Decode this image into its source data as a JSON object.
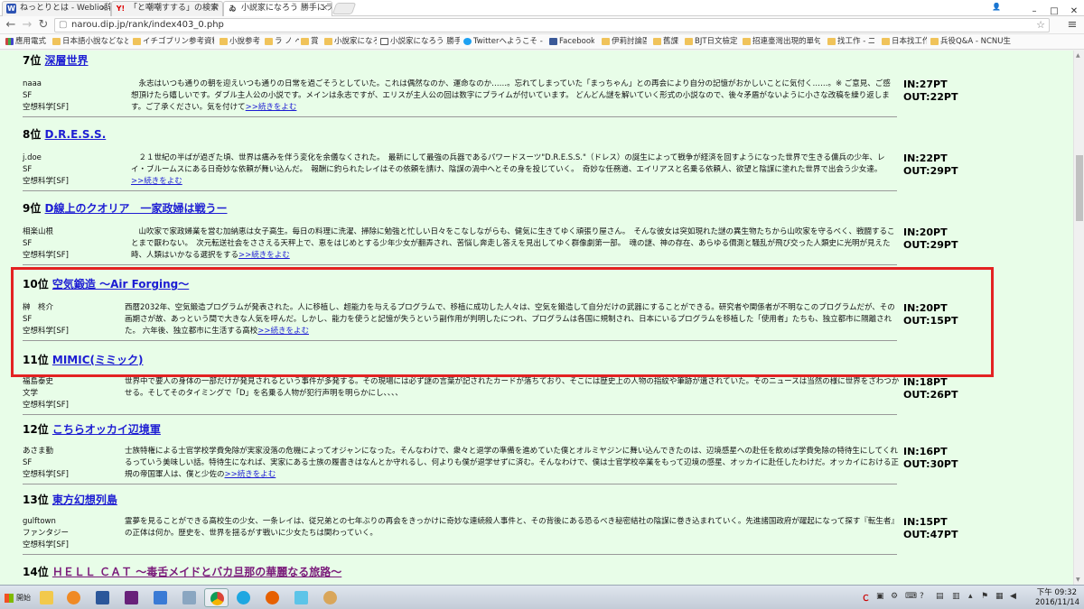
{
  "browser": {
    "tabs": [
      {
        "icon": "W",
        "title": "ねっとりとは - Weblio辞",
        "color": "#2c52b3"
      },
      {
        "icon": "Y!",
        "title": "「と嘲嘲すする」の検索",
        "color": "#d00"
      },
      {
        "icon": "ゐ",
        "title": "小説家になろう 勝手にラ",
        "color": "#333"
      }
    ],
    "url": "narou.dip.jp/rank/index403_0.php",
    "bookmarks": [
      "應用電式",
      "日本語小說などなど",
      "イチゴブリン参考資料",
      "小說参考",
      "ラ ノ ベ",
      "賞",
      "小說家になろう",
      "小説家になろう 勝手…",
      "Twitterへようこそ -",
      "Facebook",
      "伊莉討論區",
      "舊課",
      "BJT日文檢定",
      "招連臺灣出現的單句",
      "找工作 - 二",
      "日本找工作",
      "兵役Q&A - NCNU生"
    ]
  },
  "ranking": [
    {
      "rank": "7位",
      "title": "深層世界",
      "author": "naaa",
      "genre": "SF",
      "category": "空想科学[SF]",
      "synopsis": "　永志はいつも通りの朝を迎えいつも通りの日常を過ごそうとしていた。これは偶然なのか、運命なのか……。忘れてしまっていた「まっちゃん」との再会により自分の記憶がおかしいことに気付く……。※ ご意見、ご感想頂けたら嬉しいです。ダブル主人公の小説です。メインは永志ですが、エリスが主人公の回は数字にプライムが付いています。 どんどん謎を解いていく形式の小説なので、後々矛盾がないように小さな改稿を繰り返します。ご了承ください。気を付けて",
      "more": ">>続きをよむ",
      "in": "IN:27PT",
      "out": "OUT:22PT"
    },
    {
      "rank": "8位",
      "title": "D.R.E.S.S.",
      "author": "j.doe",
      "genre": "SF",
      "category": "空想科学[SF]",
      "synopsis": "　２１世紀の半ばが過ぎた頃、世界は痛みを伴う変化を余儀なくされた。　最新にして最強の兵器であるパワードスーツ\"D.R.E.S.S.\"（ドレス）の誕生によって戦争が経済を回すようになった世界で生きる傭兵の少年、レイ・ブルームスにある日奇妙な依頼が舞い込んだ。　報酬に釣られたレイはその依頼を請け、陰謀の渦中へとその身を投じていく。　奇妙な任務道、エイリアスと名乗る依頼人、欲望と陰謀に塗れた世界で出会う少女達。",
      "more": ">>続きをよむ",
      "in": "IN:22PT",
      "out": "OUT:29PT"
    },
    {
      "rank": "9位",
      "title": "D線上のクオリア　一家政婦は戦うー",
      "author": "相楽山根",
      "genre": "SF",
      "category": "空想科学[SF]",
      "synopsis": "　山吹家で家政婦業を営む加納恵は女子高生。毎日の料理に洗濯、掃除に勉強と忙しい日々をこなしながらも、健気に生きてゆく頑張り屋さん。　そんな彼女は突如現れた謎の異生物たちから山吹家を守るべく、戦闘することまで厭わない。　次元転送社会をささえる天秤上で、恵をはじめとする少年少女が翻弄され、苦悩し奔走し答えを見出してゆく群像劇第一部。　魂の謎、神の存在、あらゆる價測と騒乱が飛び交った人類史に光明が見えた時、人類はいかなる選択をする",
      "more": ">>続きをよむ",
      "in": "IN:20PT",
      "out": "OUT:29PT"
    },
    {
      "rank": "10位",
      "title": "空気鍛造 〜Air Forging〜",
      "author": "榊　柊介",
      "genre": "SF",
      "category": "空想科学[SF]",
      "synopsis": "西暦2032年、空気鍛造プログラムが発表された。人に移植し、超能力を与えるプログラムで、移植に成功した人々は、空気を鍛造して自分だけの武器にすることができる。研究者や関係者が不明なこのプログラムだが、その画期さが故、あっという間で大きな人気を呼んだ。しかし、能力を使うと記憶が失うという副作用が判明したにつれ、プログラムは各国に規制され、日本にいるプログラムを移植した「使用者」たちも、独立都市に隔離された。 六年後、独立都市に生活する高校",
      "more": ">>続きをよむ",
      "in": "IN:20PT",
      "out": "OUT:15PT"
    },
    {
      "rank": "11位",
      "title": "MIMIC(ミミック)",
      "author": "福島泰史",
      "genre": "文学",
      "category": "空想科学[SF]",
      "synopsis": "世界中で要人の身体の一部だけが発見されるという事件が多発する。その現場には必ず謎の言葉が記されたカードが落ちており、そこには歴史上の人物の指紋や筆跡が遺されていた。そのニュースは当然の様に世界をざわつかせる。そしてそのタイミングで「D」を名乗る人物が犯行声明を明らかにし、、、、",
      "more": "",
      "in": "IN:18PT",
      "out": "OUT:26PT"
    },
    {
      "rank": "12位",
      "title": "こちらオッカイ辺境軍",
      "author": "あさま勤",
      "genre": "SF",
      "category": "空想科学[SF]",
      "synopsis": "士族特権による士官学校学費免除が実家没落の危機によってオジャンになった。そんなわけで、衆々と退学の準備を進めていた僕とオルミヤジンに舞い込んできたのは、辺境感星への赴任を飲めば学費免除の特待生にしてくれるっていう美味しい話。特待生になれば、実家にある士族の履書きはなんとか守れるし、何よりも僕が退学せずに済む。そんなわけで、僕は士官学校卒業をもって辺境の感星、オッカイに赴任したわけだ。オッカイにおける正規の帝国軍人は、僕と少佐の",
      "more": ">>続きをよむ",
      "in": "IN:16PT",
      "out": "OUT:30PT"
    },
    {
      "rank": "13位",
      "title": "東方幻想列島",
      "author": "gulftown",
      "genre": "ファンタジー",
      "category": "空想科学[SF]",
      "synopsis": "霊夢を見ることができる高校生の少女、一条レイは、従兄弟との七年ぶりの再会をきっかけに奇妙な連続殺人事件と、その背後にある恐るべき秘密結社の陰謀に巻き込まれていく。先進諸国政府が躍起になって探す『転生者』の正体は何か。歴史を、世界を揺るがす戦いに少女たちは関わっていく。",
      "more": "",
      "in": "IN:15PT",
      "out": "OUT:47PT"
    },
    {
      "rank": "14位",
      "title": "ＨＥＬＬ ＣＡＴ 〜毒舌メイドとバカ旦那の華麗なる旅路〜",
      "author": "",
      "genre": "",
      "category": "",
      "synopsis": "",
      "more": "",
      "in": "",
      "out": ""
    }
  ],
  "taskbar": {
    "start_label": "開始",
    "clock_time": "下午 09:32",
    "clock_date": "2016/11/14",
    "ime": "Ｃ",
    "apps": [
      "explorer",
      "media",
      "word",
      "vs",
      "remote",
      "calc",
      "chrome",
      "ie",
      "firefox",
      "box",
      "paint"
    ]
  }
}
